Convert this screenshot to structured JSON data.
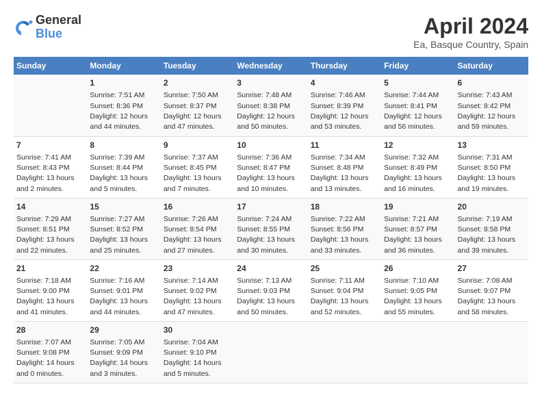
{
  "header": {
    "logo_line1": "General",
    "logo_line2": "Blue",
    "title": "April 2024",
    "subtitle": "Ea, Basque Country, Spain"
  },
  "columns": [
    "Sunday",
    "Monday",
    "Tuesday",
    "Wednesday",
    "Thursday",
    "Friday",
    "Saturday"
  ],
  "weeks": [
    [
      {
        "day": "",
        "content": ""
      },
      {
        "day": "1",
        "content": "Sunrise: 7:51 AM\nSunset: 8:36 PM\nDaylight: 12 hours\nand 44 minutes."
      },
      {
        "day": "2",
        "content": "Sunrise: 7:50 AM\nSunset: 8:37 PM\nDaylight: 12 hours\nand 47 minutes."
      },
      {
        "day": "3",
        "content": "Sunrise: 7:48 AM\nSunset: 8:38 PM\nDaylight: 12 hours\nand 50 minutes."
      },
      {
        "day": "4",
        "content": "Sunrise: 7:46 AM\nSunset: 8:39 PM\nDaylight: 12 hours\nand 53 minutes."
      },
      {
        "day": "5",
        "content": "Sunrise: 7:44 AM\nSunset: 8:41 PM\nDaylight: 12 hours\nand 56 minutes."
      },
      {
        "day": "6",
        "content": "Sunrise: 7:43 AM\nSunset: 8:42 PM\nDaylight: 12 hours\nand 59 minutes."
      }
    ],
    [
      {
        "day": "7",
        "content": "Sunrise: 7:41 AM\nSunset: 8:43 PM\nDaylight: 13 hours\nand 2 minutes."
      },
      {
        "day": "8",
        "content": "Sunrise: 7:39 AM\nSunset: 8:44 PM\nDaylight: 13 hours\nand 5 minutes."
      },
      {
        "day": "9",
        "content": "Sunrise: 7:37 AM\nSunset: 8:45 PM\nDaylight: 13 hours\nand 7 minutes."
      },
      {
        "day": "10",
        "content": "Sunrise: 7:36 AM\nSunset: 8:47 PM\nDaylight: 13 hours\nand 10 minutes."
      },
      {
        "day": "11",
        "content": "Sunrise: 7:34 AM\nSunset: 8:48 PM\nDaylight: 13 hours\nand 13 minutes."
      },
      {
        "day": "12",
        "content": "Sunrise: 7:32 AM\nSunset: 8:49 PM\nDaylight: 13 hours\nand 16 minutes."
      },
      {
        "day": "13",
        "content": "Sunrise: 7:31 AM\nSunset: 8:50 PM\nDaylight: 13 hours\nand 19 minutes."
      }
    ],
    [
      {
        "day": "14",
        "content": "Sunrise: 7:29 AM\nSunset: 8:51 PM\nDaylight: 13 hours\nand 22 minutes."
      },
      {
        "day": "15",
        "content": "Sunrise: 7:27 AM\nSunset: 8:52 PM\nDaylight: 13 hours\nand 25 minutes."
      },
      {
        "day": "16",
        "content": "Sunrise: 7:26 AM\nSunset: 8:54 PM\nDaylight: 13 hours\nand 27 minutes."
      },
      {
        "day": "17",
        "content": "Sunrise: 7:24 AM\nSunset: 8:55 PM\nDaylight: 13 hours\nand 30 minutes."
      },
      {
        "day": "18",
        "content": "Sunrise: 7:22 AM\nSunset: 8:56 PM\nDaylight: 13 hours\nand 33 minutes."
      },
      {
        "day": "19",
        "content": "Sunrise: 7:21 AM\nSunset: 8:57 PM\nDaylight: 13 hours\nand 36 minutes."
      },
      {
        "day": "20",
        "content": "Sunrise: 7:19 AM\nSunset: 8:58 PM\nDaylight: 13 hours\nand 39 minutes."
      }
    ],
    [
      {
        "day": "21",
        "content": "Sunrise: 7:18 AM\nSunset: 9:00 PM\nDaylight: 13 hours\nand 41 minutes."
      },
      {
        "day": "22",
        "content": "Sunrise: 7:16 AM\nSunset: 9:01 PM\nDaylight: 13 hours\nand 44 minutes."
      },
      {
        "day": "23",
        "content": "Sunrise: 7:14 AM\nSunset: 9:02 PM\nDaylight: 13 hours\nand 47 minutes."
      },
      {
        "day": "24",
        "content": "Sunrise: 7:13 AM\nSunset: 9:03 PM\nDaylight: 13 hours\nand 50 minutes."
      },
      {
        "day": "25",
        "content": "Sunrise: 7:11 AM\nSunset: 9:04 PM\nDaylight: 13 hours\nand 52 minutes."
      },
      {
        "day": "26",
        "content": "Sunrise: 7:10 AM\nSunset: 9:05 PM\nDaylight: 13 hours\nand 55 minutes."
      },
      {
        "day": "27",
        "content": "Sunrise: 7:08 AM\nSunset: 9:07 PM\nDaylight: 13 hours\nand 58 minutes."
      }
    ],
    [
      {
        "day": "28",
        "content": "Sunrise: 7:07 AM\nSunset: 9:08 PM\nDaylight: 14 hours\nand 0 minutes."
      },
      {
        "day": "29",
        "content": "Sunrise: 7:05 AM\nSunset: 9:09 PM\nDaylight: 14 hours\nand 3 minutes."
      },
      {
        "day": "30",
        "content": "Sunrise: 7:04 AM\nSunset: 9:10 PM\nDaylight: 14 hours\nand 5 minutes."
      },
      {
        "day": "",
        "content": ""
      },
      {
        "day": "",
        "content": ""
      },
      {
        "day": "",
        "content": ""
      },
      {
        "day": "",
        "content": ""
      }
    ]
  ]
}
